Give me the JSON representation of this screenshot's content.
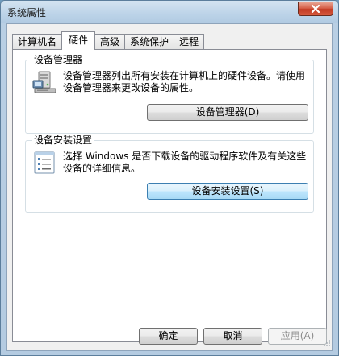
{
  "window": {
    "title": "系统属性"
  },
  "tabs": [
    {
      "label": "计算机名"
    },
    {
      "label": "硬件"
    },
    {
      "label": "高级"
    },
    {
      "label": "系统保护"
    },
    {
      "label": "远程"
    }
  ],
  "active_tab": "硬件",
  "device_manager": {
    "heading": "设备管理器",
    "description": "设备管理器列出所有安装在计算机上的硬件设备。请使用设备管理器来更改设备的属性。",
    "button_label": "设备管理器(D)",
    "icon": "device-manager-icon"
  },
  "device_installation": {
    "heading": "设备安装设置",
    "description": "选择 Windows 是否下载设备的驱动程序软件及有关这些设备的详细信息。",
    "button_label": "设备安装设置(S)",
    "icon": "checklist-icon"
  },
  "footer": {
    "ok_label": "确定",
    "cancel_label": "取消",
    "apply_label": "应用(A)"
  },
  "colors": {
    "title_bar": "#bcd3e8",
    "close_button": "#c23a23",
    "focused_button_border": "#3c7fb1",
    "disabled_text": "#8d8d8d"
  }
}
